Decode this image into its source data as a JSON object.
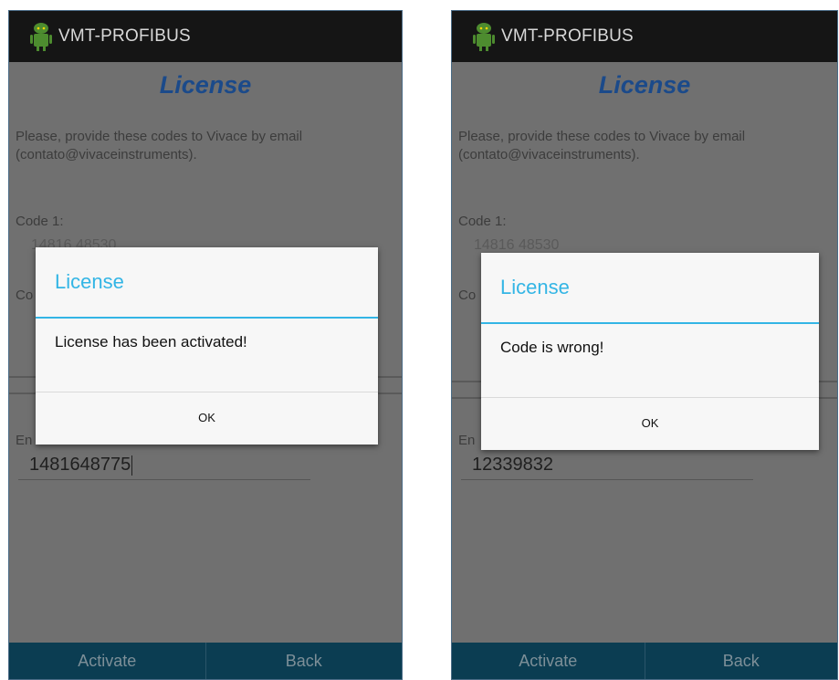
{
  "screens": [
    {
      "app_title": "VMT-PROFIBUS",
      "screen_title": "License",
      "instructions": "Please, provide these codes to Vivace by email (contato@vivaceinstruments).",
      "code1_label": "Code 1:",
      "code1_value": "14816 48530",
      "code2_label": "Co",
      "code2_value": "",
      "enter_label": "En",
      "enter_value": "1481648775",
      "activate_label": "Activate",
      "back_label": "Back",
      "dialog": {
        "title": "License",
        "message": "License has been activated!",
        "ok_label": "OK"
      }
    },
    {
      "app_title": "VMT-PROFIBUS",
      "screen_title": "License",
      "instructions": "Please, provide these codes to Vivace by email (contato@vivaceinstruments).",
      "code1_label": "Code 1:",
      "code1_value": "14816 48530",
      "code2_label": "Co",
      "code2_value": "",
      "enter_label": "En",
      "enter_value": "12339832",
      "activate_label": "Activate",
      "back_label": "Back",
      "dialog": {
        "title": "License",
        "message": "Code is wrong!",
        "ok_label": "OK"
      }
    }
  ]
}
